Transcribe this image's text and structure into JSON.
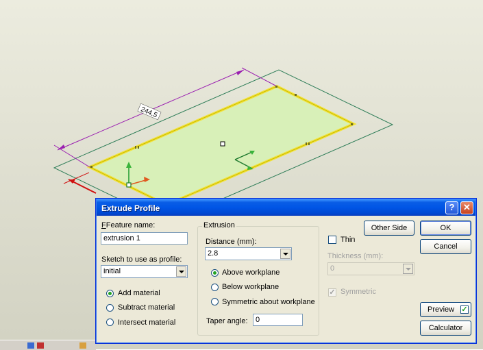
{
  "viewport": {
    "dimension_label": "244.5"
  },
  "dialog": {
    "title": "Extrude Profile",
    "help_glyph": "?",
    "close_glyph": "✕",
    "feature_name_label": "Feature name:",
    "feature_name_value": "extrusion 1",
    "sketch_label": "Sketch to use as profile:",
    "sketch_value": "initial",
    "material_options": [
      {
        "label": "Add material",
        "selected": true
      },
      {
        "label": "Subtract material",
        "selected": false
      },
      {
        "label": "Intersect material",
        "selected": false
      }
    ],
    "extrusion_group_label": "Extrusion",
    "distance_label": "Distance (mm):",
    "distance_value": "2.8",
    "workplane_options": [
      {
        "label": "Above workplane",
        "selected": true
      },
      {
        "label": "Below workplane",
        "selected": false
      },
      {
        "label": "Symmetric about workplane",
        "selected": false
      }
    ],
    "taper_label": "Taper angle:",
    "taper_value": "0",
    "thin_label": "Thin",
    "thin_checked": false,
    "thickness_label": "Thickness (mm):",
    "thickness_value": "0",
    "symmetric_label": "Symmetric",
    "symmetric_checked": true,
    "other_side_label": "Other Side",
    "ok_label": "OK",
    "cancel_label": "Cancel",
    "preview_label": "Preview",
    "preview_checked": true,
    "calculator_label": "Calculator",
    "check_glyph": "✓"
  }
}
